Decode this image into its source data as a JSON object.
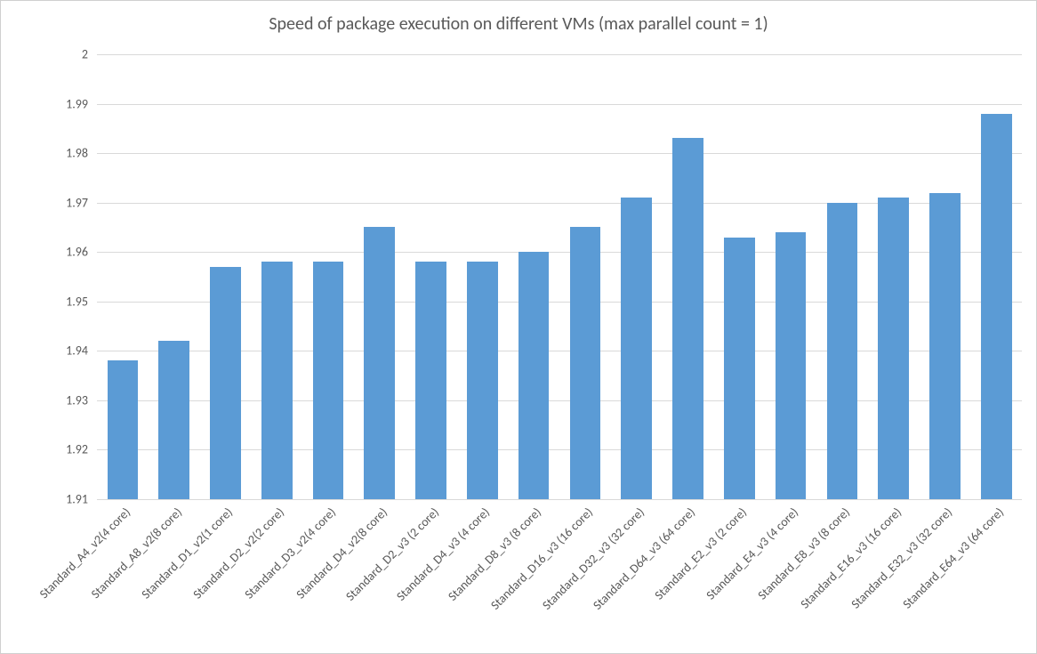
{
  "chart_data": {
    "type": "bar",
    "title": "Speed of package execution on different VMs (max parallel count = 1)",
    "xlabel": "",
    "ylabel": "",
    "ylim": [
      1.91,
      2.0
    ],
    "yticks": [
      1.91,
      1.92,
      1.93,
      1.94,
      1.95,
      1.96,
      1.97,
      1.98,
      1.99,
      2.0
    ],
    "categories": [
      "Standard_A4_v2(4 core)",
      "Standard_A8_v2(8 core)",
      "Standard_D1_v2(1 core)",
      "Standard_D2_v2(2 core)",
      "Standard_D3_v2(4 core)",
      "Standard_D4_v2(8 core)",
      "Standard_D2_v3 (2 core)",
      "Standard_D4_v3 (4 core)",
      "Standard_D8_v3 (8 core)",
      "Standard_D16_v3 (16 core)",
      "Standard_D32_v3 (32 core)",
      "Standard_D64_v3 (64 core)",
      "Standard_E2_v3 (2 core)",
      "Standard_E4_v3 (4 core)",
      "Standard_E8_v3 (8 core)",
      "Standard_E16_v3 (16 core)",
      "Standard_E32_v3 (32 core)",
      "Standard_E64_v3 (64 core)"
    ],
    "values": [
      1.938,
      1.942,
      1.957,
      1.958,
      1.958,
      1.965,
      1.958,
      1.958,
      1.96,
      1.965,
      1.971,
      1.983,
      1.963,
      1.964,
      1.97,
      1.971,
      1.972,
      1.988
    ],
    "bar_color": "#5b9bd5",
    "gridline_color": "#d9d9d9",
    "text_color": "#595959"
  }
}
